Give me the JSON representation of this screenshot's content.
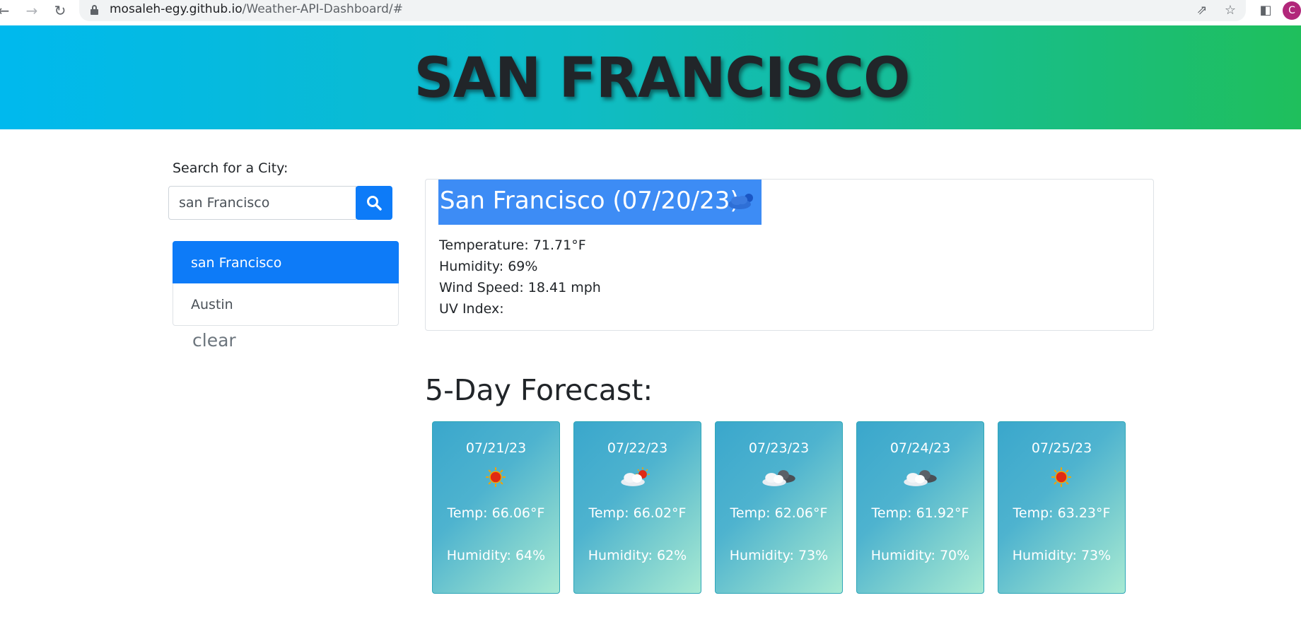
{
  "browser": {
    "url_host": "mosaleh-egy.github.io",
    "url_path": "/Weather-API-Dashboard/#",
    "profile_initial": "C"
  },
  "header": {
    "title": "SAN FRANCISCO"
  },
  "sidebar": {
    "search_label": "Search for a City:",
    "search_value": "san Francisco",
    "history": [
      "san Francisco",
      "Austin"
    ],
    "clear_label": "clear"
  },
  "current": {
    "title": "San Francisco (07/20/23)",
    "icon": "few-clouds-icon",
    "temperature": "Temperature: 71.71°F",
    "humidity": "Humidity: 69%",
    "wind": "Wind Speed: 18.41 mph",
    "uv": "UV Index:"
  },
  "forecast": {
    "title": "5-Day Forecast:",
    "days": [
      {
        "date": "07/21/23",
        "icon": "sun-icon",
        "temp": "Temp: 66.06°F",
        "humidity": "Humidity: 64%"
      },
      {
        "date": "07/22/23",
        "icon": "sun-behind-cloud-icon",
        "temp": "Temp: 66.02°F",
        "humidity": "Humidity: 62%"
      },
      {
        "date": "07/23/23",
        "icon": "clouds-icon",
        "temp": "Temp: 62.06°F",
        "humidity": "Humidity: 73%"
      },
      {
        "date": "07/24/23",
        "icon": "clouds-icon",
        "temp": "Temp: 61.92°F",
        "humidity": "Humidity: 70%"
      },
      {
        "date": "07/25/23",
        "icon": "sun-icon",
        "temp": "Temp: 63.23°F",
        "humidity": "Humidity: 73%"
      }
    ]
  }
}
